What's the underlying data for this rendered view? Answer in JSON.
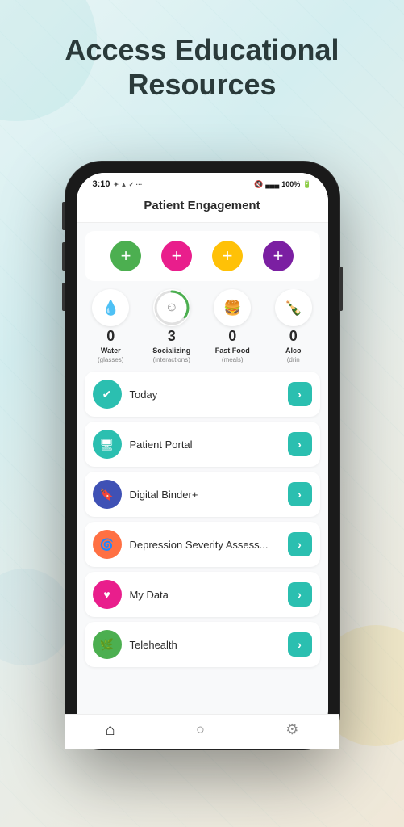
{
  "page": {
    "title_line1": "Access Educational",
    "title_line2": "Resources"
  },
  "status_bar": {
    "time": "3:10",
    "left_icons": "✦ ▲ ✓ ···",
    "right_icons": "🔇 📶 100%"
  },
  "app_header": {
    "title": "Patient Engagement"
  },
  "add_buttons": [
    {
      "color": "#4CAF50",
      "label": "+"
    },
    {
      "color": "#e91e8c",
      "label": "+"
    },
    {
      "color": "#FFC107",
      "label": "+"
    },
    {
      "color": "#7B1FA2",
      "label": "+"
    }
  ],
  "stats": [
    {
      "icon": "💧",
      "value": "0",
      "label": "Water",
      "sublabel": "(glasses)",
      "color": "#9ecfcf"
    },
    {
      "icon": "☺",
      "value": "3",
      "label": "Socializing",
      "sublabel": "(interactions)",
      "color": "#4CAF50",
      "has_arc": true
    },
    {
      "icon": "🍔",
      "value": "0",
      "label": "Fast Food",
      "sublabel": "(meals)",
      "color": "#e57373"
    },
    {
      "icon": "🍾",
      "value": "0",
      "label": "Alco",
      "sublabel": "(drin",
      "color": "#e57373"
    }
  ],
  "menu_items": [
    {
      "id": "today",
      "label": "Today",
      "icon": "✔",
      "icon_bg": "#2bbfb0",
      "icon_color": "white"
    },
    {
      "id": "patient-portal",
      "label": "Patient Portal",
      "icon": "🖥",
      "icon_bg": "#2bbfb0",
      "icon_color": "white"
    },
    {
      "id": "digital-binder",
      "label": "Digital Binder+",
      "icon": "🔖",
      "icon_bg": "#3f51b5",
      "icon_color": "white"
    },
    {
      "id": "depression",
      "label": "Depression Severity Assess...",
      "icon": "🌀",
      "icon_bg": "#ff7043",
      "icon_color": "white"
    },
    {
      "id": "my-data",
      "label": "My Data",
      "icon": "♥",
      "icon_bg": "#e91e8c",
      "icon_color": "white"
    },
    {
      "id": "telehealth",
      "label": "Telehealth",
      "icon": "🌿",
      "icon_bg": "#4CAF50",
      "icon_color": "white"
    }
  ],
  "bottom_nav": [
    {
      "icon": "⌂",
      "active": true
    },
    {
      "icon": "○",
      "active": false
    },
    {
      "icon": "⚙",
      "active": false
    }
  ],
  "arrow_label": "›"
}
